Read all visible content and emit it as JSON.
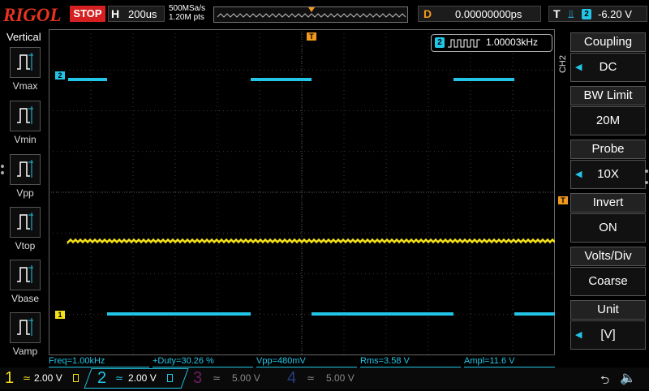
{
  "header": {
    "logo": "RIGOL",
    "run_status": "STOP",
    "horizontal_key": "H",
    "timebase": "200us",
    "sample_rate": "500MSa/s",
    "memory_depth": "1.20M pts",
    "delay_key": "D",
    "delay": "0.00000000ps",
    "trigger_key": "T",
    "trigger_source": "2",
    "trigger_level": "-6.20 V"
  },
  "left_panel": {
    "title": "Vertical",
    "items": [
      {
        "label": "Vmax",
        "icon": "vmax-icon"
      },
      {
        "label": "Vmin",
        "icon": "vmin-icon"
      },
      {
        "label": "Vpp",
        "icon": "vpp-icon"
      },
      {
        "label": "Vtop",
        "icon": "vtop-icon"
      },
      {
        "label": "Vbase",
        "icon": "vbase-icon"
      },
      {
        "label": "Vamp",
        "icon": "vamp-icon"
      }
    ]
  },
  "right_menu": {
    "channel_tag": "CH2",
    "items": [
      {
        "label": "Coupling",
        "value": "DC"
      },
      {
        "label": "BW Limit",
        "value": "20M"
      },
      {
        "label": "Probe",
        "value": "10X"
      },
      {
        "label": "Invert",
        "value": "ON"
      },
      {
        "label": "Volts/Div",
        "value": "Coarse"
      },
      {
        "label": "Unit",
        "value": "[V]"
      }
    ]
  },
  "freq_counter": {
    "channel": "2",
    "value": "1.00003kHz"
  },
  "markers": {
    "ch1": "1",
    "ch2": "2",
    "trigger": "T"
  },
  "measurements": [
    {
      "text": "Freq=1.00kHz"
    },
    {
      "text": "+Duty=30.26 %"
    },
    {
      "text": "Vpp=480mV"
    },
    {
      "text": "Rms=3.58 V"
    },
    {
      "text": "Ampl=11.6 V"
    }
  ],
  "channels": [
    {
      "num": "1",
      "scale": "2.00 V",
      "color": "#f5e11a"
    },
    {
      "num": "2",
      "scale": "2.00 V",
      "color": "#22c5e6"
    },
    {
      "num": "3",
      "scale": "5.00 V",
      "color": "#c02aa8"
    },
    {
      "num": "4",
      "scale": "5.00 V",
      "color": "#3a5fd0"
    }
  ],
  "colors": {
    "ch1": "#f5e11a",
    "ch2": "#22c5e6",
    "trigger": "#f29a1b",
    "stop": "#d42020"
  }
}
